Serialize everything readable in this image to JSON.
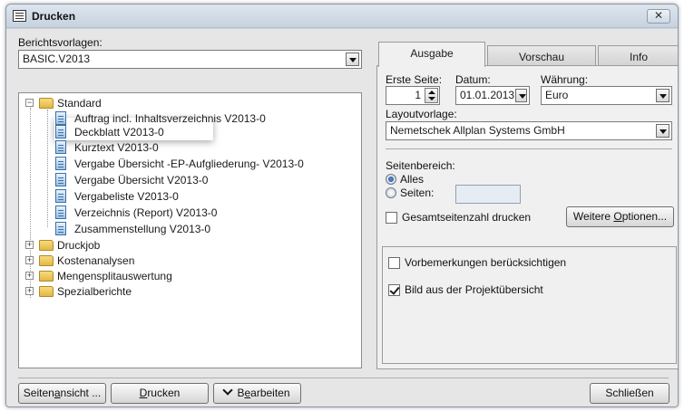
{
  "window": {
    "title": "Drucken",
    "close_glyph": "✕"
  },
  "left": {
    "label_vorlagen": "Berichtsvorlagen:",
    "vorlagen_value": "BASIC.V2013",
    "tree": {
      "standard": "Standard",
      "items": [
        "Auftrag incl. Inhaltsverzeichnis V2013-0",
        "Deckblatt V2013-0",
        "Kurztext V2013-0",
        "Vergabe Übersicht -EP-Aufgliederung- V2013-0",
        "Vergabe Übersicht V2013-0",
        "Vergabeliste V2013-0",
        "Verzeichnis (Report) V2013-0",
        "Zusammenstellung V2013-0"
      ],
      "folders": [
        "Druckjob",
        "Kostenanalysen",
        "Mengensplitauswertung",
        "Spezialberichte"
      ]
    }
  },
  "tabs": {
    "ausgabe": "Ausgabe",
    "vorschau": "Vorschau",
    "info": "Info"
  },
  "ausgabe": {
    "erste_seite_label": "Erste Seite:",
    "erste_seite_value": "1",
    "datum_label": "Datum:",
    "datum_value": "01.01.2013",
    "waehrung_label": "Währung:",
    "waehrung_value": "Euro",
    "layout_label": "Layoutvorlage:",
    "layout_value": "Nemetschek Allplan Systems GmbH",
    "seitenbereich_label": "Seitenbereich:",
    "radio_alles": "Alles",
    "radio_seiten": "Seiten:",
    "gesamtseiten_label": "Gesamtseitenzahl drucken",
    "weitere_pre": "Weitere ",
    "weitere_u": "O",
    "weitere_post": "ptionen...",
    "vorbemerkungen_label": "Vorbemerkungen berücksichtigen",
    "bild_label": "Bild aus der Projektübersicht"
  },
  "footer": {
    "seitenansicht_pre": "Seiten",
    "seitenansicht_u": "a",
    "seitenansicht_post": "nsicht ...",
    "drucken_u": "D",
    "drucken_post": "rucken",
    "bearbeiten_pre": "B",
    "bearbeiten_u": "e",
    "bearbeiten_post": "arbeiten",
    "schliessen": "Schließen"
  }
}
